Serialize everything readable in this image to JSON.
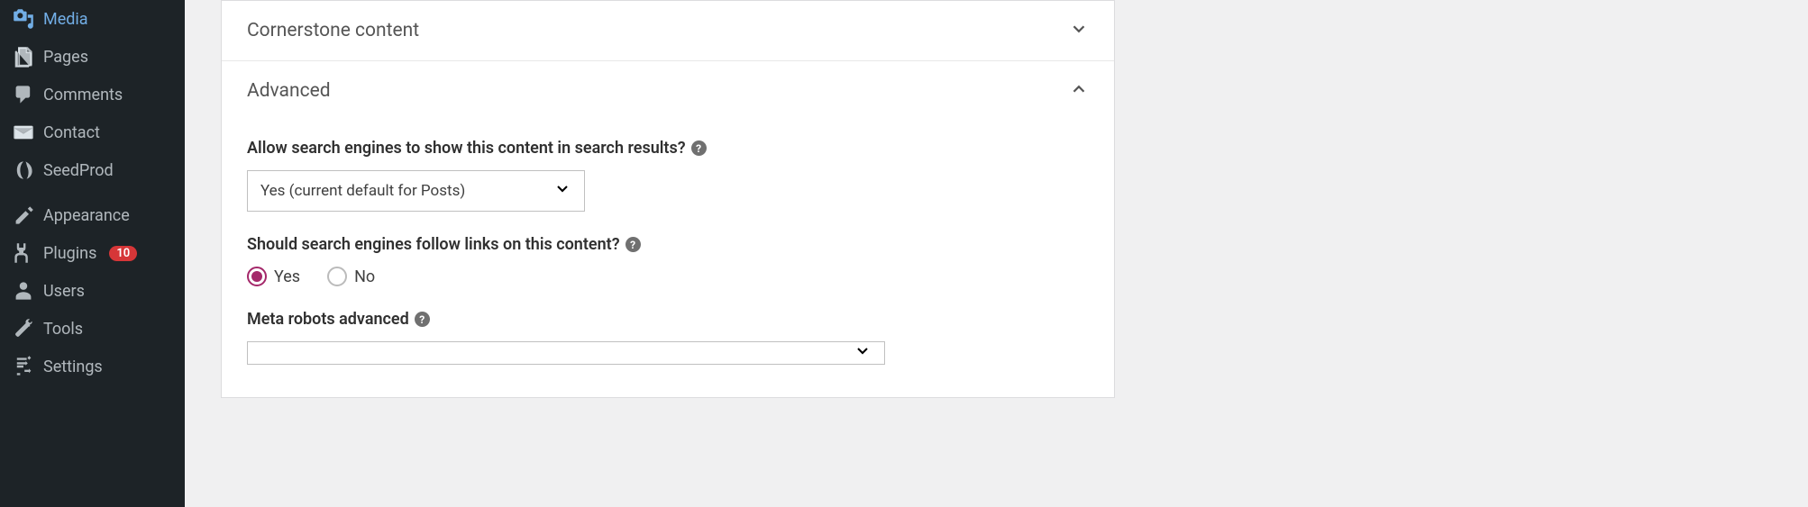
{
  "sidebar": {
    "items": [
      {
        "label": "Media",
        "icon": "media"
      },
      {
        "label": "Pages",
        "icon": "pages"
      },
      {
        "label": "Comments",
        "icon": "comments"
      },
      {
        "label": "Contact",
        "icon": "contact"
      },
      {
        "label": "SeedProd",
        "icon": "seedprod"
      },
      {
        "label": "Appearance",
        "icon": "appearance",
        "separator": true
      },
      {
        "label": "Plugins",
        "icon": "plugins",
        "badge": "10"
      },
      {
        "label": "Users",
        "icon": "users"
      },
      {
        "label": "Tools",
        "icon": "tools"
      },
      {
        "label": "Settings",
        "icon": "settings"
      }
    ]
  },
  "accordions": {
    "cornerstone": {
      "title": "Cornerstone content",
      "expanded": false
    },
    "advanced": {
      "title": "Advanced",
      "expanded": true
    }
  },
  "advanced": {
    "allow_search": {
      "label": "Allow search engines to show this content in search results?",
      "selected": "Yes (current default for Posts)"
    },
    "follow_links": {
      "label": "Should search engines follow links on this content?",
      "options": {
        "yes": "Yes",
        "no": "No"
      },
      "selected": "yes"
    },
    "meta_robots": {
      "label": "Meta robots advanced",
      "selected": ""
    }
  }
}
